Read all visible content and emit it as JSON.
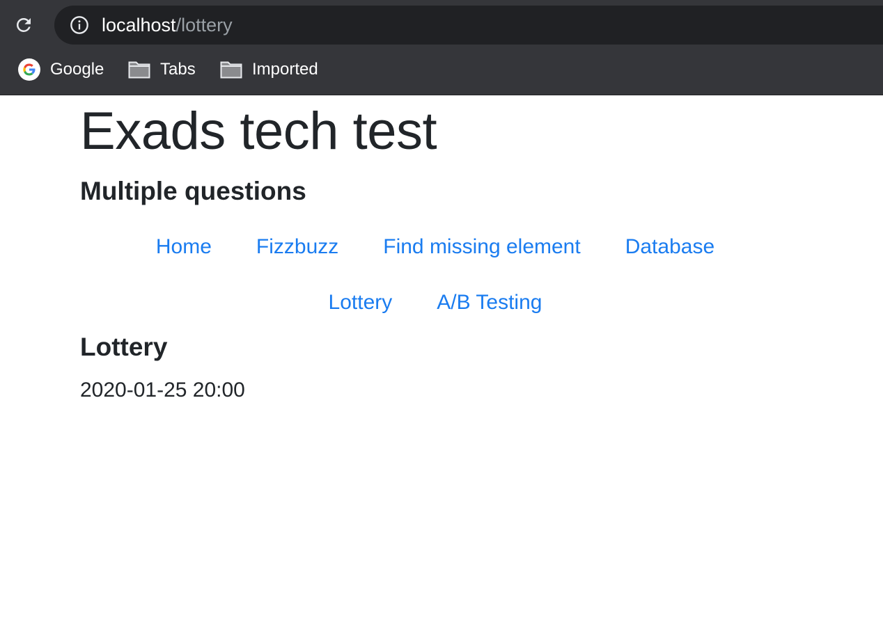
{
  "browser": {
    "url_host": "localhost",
    "url_path": "/lottery",
    "bookmarks": [
      {
        "label": "Google",
        "icon": "google-icon"
      },
      {
        "label": "Tabs",
        "icon": "folder-icon"
      },
      {
        "label": "Imported",
        "icon": "folder-icon"
      }
    ],
    "colors": {
      "toolbar": "#35363a",
      "omnibox": "#202124"
    }
  },
  "page": {
    "title": "Exads tech test",
    "subtitle": "Multiple questions",
    "nav_row1": [
      "Home",
      "Fizzbuzz",
      "Find missing element",
      "Database"
    ],
    "nav_row2": [
      "Lottery",
      "A/B Testing"
    ],
    "section_title": "Lottery",
    "lottery_date": "2020-01-25 20:00",
    "colors": {
      "link": "#1a7cf0",
      "text": "#212529"
    }
  }
}
